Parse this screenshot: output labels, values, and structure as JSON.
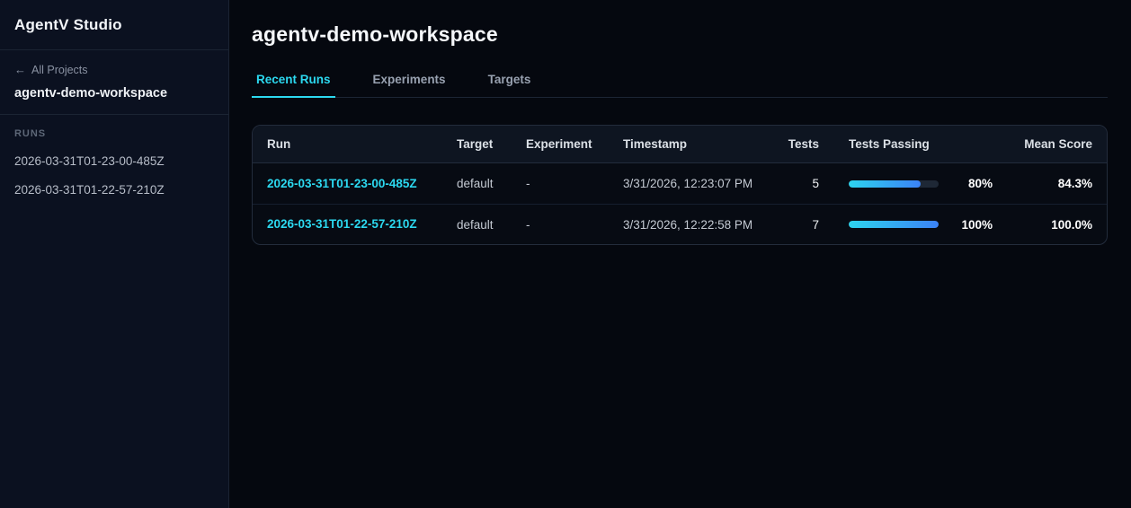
{
  "sidebar": {
    "app_title": "AgentV Studio",
    "back_link_label": "All Projects",
    "workspace_name": "agentv-demo-workspace",
    "runs_section_label": "RUNS",
    "runs": [
      "2026-03-31T01-23-00-485Z",
      "2026-03-31T01-22-57-210Z"
    ]
  },
  "icons": {
    "back_arrow": "←"
  },
  "main": {
    "title": "agentv-demo-workspace",
    "tabs": [
      {
        "label": "Recent Runs",
        "active": true
      },
      {
        "label": "Experiments",
        "active": false
      },
      {
        "label": "Targets",
        "active": false
      }
    ]
  },
  "table": {
    "columns": {
      "run": "Run",
      "target": "Target",
      "experiment": "Experiment",
      "timestamp": "Timestamp",
      "tests": "Tests",
      "tests_passing": "Tests Passing",
      "mean_score": "Mean Score"
    },
    "rows": [
      {
        "run": "2026-03-31T01-23-00-485Z",
        "target": "default",
        "experiment": "-",
        "timestamp": "3/31/2026, 12:23:07 PM",
        "tests": "5",
        "tests_passing_pct": 80,
        "tests_passing_label": "80%",
        "mean_score": "84.3%"
      },
      {
        "run": "2026-03-31T01-22-57-210Z",
        "target": "default",
        "experiment": "-",
        "timestamp": "3/31/2026, 12:22:58 PM",
        "tests": "7",
        "tests_passing_pct": 100,
        "tests_passing_label": "100%",
        "mean_score": "100.0%"
      }
    ]
  },
  "colors": {
    "accent_cyan": "#2cd9f0",
    "bar_gradient_start": "#2dd4ee",
    "bar_gradient_end": "#3b82f6",
    "sidebar_bg": "#0b1120",
    "page_bg": "#05080f"
  }
}
